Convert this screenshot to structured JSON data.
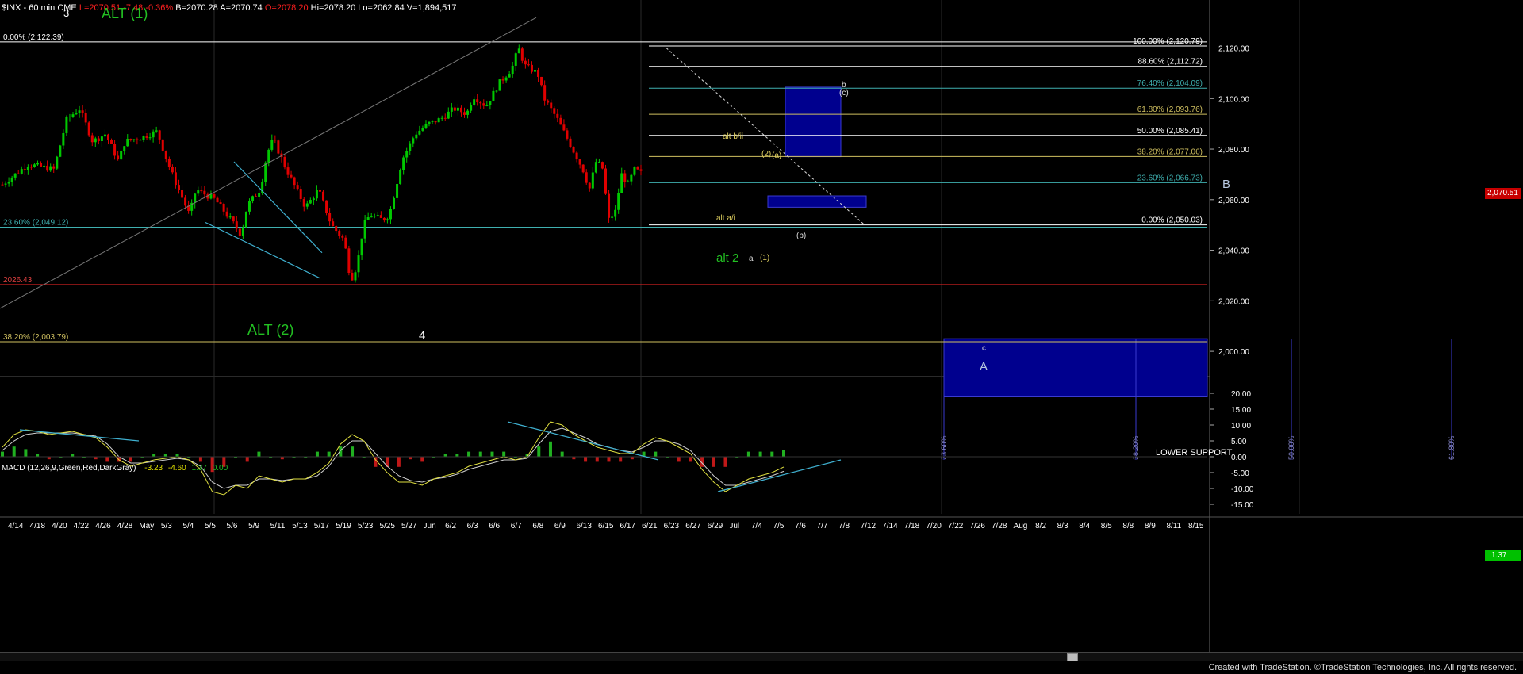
{
  "header": {
    "symbol": "$INX - 60 min",
    "exchange": "CME",
    "last": "L=2070.51",
    "change": "-7.48",
    "change_pct": "-0.36%",
    "bid": "B=2070.28",
    "ask": "A=2070.74",
    "open": "O=2078.20",
    "high": "Hi=2078.20",
    "low": "Lo=2062.84",
    "volume": "V=1,894,517"
  },
  "colors": {
    "up": "#00c800",
    "down": "#e00000",
    "box": "#00008e",
    "price_tag": "#c80000",
    "macd_tag": "#00c000"
  },
  "chart_data": [
    {
      "type": "candlestick",
      "title": "$INX - 60 min",
      "x_tick_labels": [
        "4/14",
        "4/18",
        "4/20",
        "4/22",
        "4/26",
        "4/28",
        "May",
        "5/3",
        "5/4",
        "5/5",
        "5/6",
        "5/9",
        "5/11",
        "5/13",
        "5/17",
        "5/19",
        "5/23",
        "5/25",
        "5/27",
        "Jun",
        "6/2",
        "6/3",
        "6/6",
        "6/7",
        "6/8",
        "6/9",
        "6/13",
        "6/15",
        "6/17",
        "6/21",
        "6/23",
        "6/27",
        "6/29",
        "Jul",
        "7/4",
        "7/5",
        "7/6",
        "7/7",
        "7/8",
        "7/12",
        "7/14",
        "7/18",
        "7/20",
        "7/22",
        "7/26",
        "7/28",
        "Aug",
        "8/2",
        "8/3",
        "8/4",
        "8/5",
        "8/8",
        "8/9",
        "8/11",
        "8/15"
      ],
      "y_ticks": [
        "2,120.00",
        "2,100.00",
        "2,080.00",
        "2,060.00",
        "2,040.00",
        "2,020.00",
        "2,000.00"
      ],
      "ylim": [
        1990,
        2128
      ],
      "last_price_tag": "2,070.51",
      "price_path": [
        [
          0,
          2066
        ],
        [
          4,
          2074
        ],
        [
          8,
          2072
        ],
        [
          10,
          2092
        ],
        [
          12,
          2096
        ],
        [
          14,
          2083
        ],
        [
          16,
          2086
        ],
        [
          18,
          2075
        ],
        [
          19,
          2083
        ],
        [
          22,
          2085
        ],
        [
          24,
          2087
        ],
        [
          26,
          2072
        ],
        [
          27,
          2066
        ],
        [
          29,
          2054
        ],
        [
          30,
          2064
        ],
        [
          33,
          2060
        ],
        [
          36,
          2050
        ],
        [
          37,
          2046
        ],
        [
          38,
          2058
        ],
        [
          40,
          2064
        ],
        [
          41,
          2078
        ],
        [
          42,
          2084
        ],
        [
          44,
          2072
        ],
        [
          46,
          2062
        ],
        [
          47,
          2057
        ],
        [
          49,
          2064
        ],
        [
          51,
          2050
        ],
        [
          53,
          2044
        ],
        [
          54,
          2028
        ],
        [
          55,
          2034
        ],
        [
          56,
          2050
        ],
        [
          57,
          2054
        ],
        [
          59,
          2052
        ],
        [
          60,
          2054
        ],
        [
          62,
          2076
        ],
        [
          64,
          2086
        ],
        [
          66,
          2090
        ],
        [
          68,
          2092
        ],
        [
          70,
          2096
        ],
        [
          72,
          2094
        ],
        [
          73,
          2101
        ],
        [
          75,
          2097
        ],
        [
          77,
          2106
        ],
        [
          79,
          2112
        ],
        [
          80,
          2120
        ],
        [
          81,
          2113
        ],
        [
          83,
          2110
        ],
        [
          84,
          2100
        ],
        [
          86,
          2092
        ],
        [
          88,
          2082
        ],
        [
          90,
          2072
        ],
        [
          91,
          2064
        ],
        [
          92,
          2075
        ],
        [
          93,
          2073
        ],
        [
          94,
          2052
        ],
        [
          95,
          2055
        ],
        [
          96,
          2070
        ],
        [
          97,
          2066
        ],
        [
          98,
          2072
        ],
        [
          99,
          2070.51
        ]
      ],
      "fib_upper": [
        {
          "label": "100.00% (2,120.79)",
          "value": 2120.79
        },
        {
          "label": "88.60% (2,112.72)",
          "value": 2112.72
        },
        {
          "label": "76.40% (2,104.09)",
          "value": 2104.09
        },
        {
          "label": "61.80% (2,093.76)",
          "value": 2093.76
        },
        {
          "label": "50.00% (2,085.41)",
          "value": 2085.41
        },
        {
          "label": "38.20% (2,077.06)",
          "value": 2077.06
        },
        {
          "label": "23.60% (2,066.73)",
          "value": 2066.73
        },
        {
          "label": "0.00% (2,050.03)",
          "value": 2050.03
        }
      ],
      "fib_left": [
        {
          "label": "0.00% (2,122.39)",
          "value": 2122.39
        },
        {
          "label": "23.60% (2,049.12)",
          "value": 2049.12
        },
        {
          "label": "38.20% (2,003.79)",
          "value": 2003.79
        }
      ],
      "support_line": {
        "label": "2026.43",
        "value": 2026.43
      },
      "boxes": [
        {
          "name": "upper-target-box",
          "y_top": 2104.5,
          "y_bottom": 2077
        },
        {
          "name": "b-target-box",
          "y_top": 2061.5,
          "y_bottom": 2057
        },
        {
          "name": "lower-support-box",
          "y_top": 2005,
          "y_bottom": 1982,
          "label": "LOWER SUPPORT"
        }
      ],
      "lower_box_fibs": [
        "23.60%",
        "38.20%",
        "50.00%",
        "61.80%"
      ],
      "annotations": {
        "top_left_partial": "ALT (1)",
        "top_left_3": "3",
        "alt_2_big": "ALT (2)",
        "wave_4": "4",
        "alt_2_small": "alt 2",
        "alt_ai": "alt a/i",
        "alt_bii": "alt b/ii",
        "wave_2": "(2)",
        "wave_a_paren": "(a)",
        "wave_a": "a",
        "wave_1": "(1)",
        "wave_b_paren": "(b)",
        "wave_b": "b",
        "wave_c_paren": "(c)",
        "big_B": "B",
        "small_c": "c",
        "big_A": "A"
      }
    },
    {
      "type": "line",
      "title": "MACD (12,26,9,Green,Red,DarkGray)",
      "values_text": [
        "-3.23",
        "-4.60",
        "1.37",
        "0.00"
      ],
      "y_ticks": [
        "20.00",
        "15.00",
        "10.00",
        "5.00",
        "0.00",
        "-5.00",
        "-10.00",
        "-15.00"
      ],
      "ylim": [
        -18,
        22
      ],
      "last_value_tag": "1.37",
      "series": [
        {
          "name": "MACD",
          "values": [
            3,
            7,
            8.5,
            8,
            7,
            7.5,
            8,
            7,
            6,
            3,
            -1,
            -3,
            -2,
            -1,
            -0.5,
            0,
            -1,
            -4,
            -11,
            -12,
            -9,
            -10,
            -6,
            -7,
            -8,
            -7,
            -7,
            -5,
            -2,
            4,
            7,
            5,
            -1,
            -5,
            -8,
            -8,
            -9,
            -7,
            -6,
            -5,
            -3,
            -2,
            -1,
            0,
            -1,
            0,
            6,
            11,
            10,
            7,
            5,
            3,
            2,
            1,
            1,
            4,
            6,
            5,
            3,
            1,
            -4,
            -8,
            -11,
            -9,
            -7,
            -6,
            -5,
            -3.23
          ]
        },
        {
          "name": "Signal",
          "values": [
            2,
            5,
            7,
            7.5,
            7.5,
            7.5,
            7.5,
            7,
            6.5,
            4,
            0,
            -2,
            -2,
            -1.5,
            -1,
            -0.5,
            -1,
            -3,
            -8,
            -10,
            -9,
            -9,
            -7,
            -7,
            -7.5,
            -7,
            -7,
            -6,
            -3,
            2,
            5,
            5,
            1,
            -3,
            -6,
            -7.5,
            -8,
            -7,
            -6.5,
            -5.5,
            -4,
            -3,
            -2,
            -1,
            -1,
            -0.5,
            4,
            8,
            9,
            7.5,
            6,
            4,
            3,
            2,
            1.5,
            3,
            5,
            5,
            4,
            2,
            -2,
            -6,
            -9,
            -9,
            -8,
            -7,
            -6,
            -4.6
          ]
        }
      ]
    }
  ],
  "footer_text": "Created with TradeStation. ©TradeStation Technologies, Inc. All rights reserved."
}
